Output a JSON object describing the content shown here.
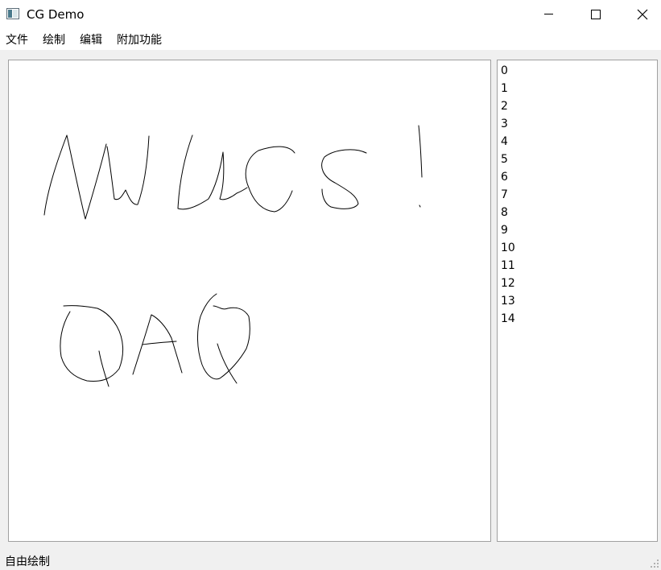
{
  "window": {
    "title": "CG Demo",
    "controls": {
      "minimize": "minimize-icon",
      "maximize": "maximize-icon",
      "close": "close-icon"
    }
  },
  "menubar": {
    "items": [
      {
        "label": "文件"
      },
      {
        "label": "绘制"
      },
      {
        "label": "编辑"
      },
      {
        "label": "附加功能"
      }
    ]
  },
  "canvas": {
    "background": "#ffffff",
    "stroke_color": "#000000",
    "stroke_count": 15
  },
  "list": {
    "items": [
      "0",
      "1",
      "2",
      "3",
      "4",
      "5",
      "6",
      "7",
      "8",
      "9",
      "10",
      "11",
      "12",
      "13",
      "14"
    ]
  },
  "status": {
    "text": "自由绘制"
  }
}
